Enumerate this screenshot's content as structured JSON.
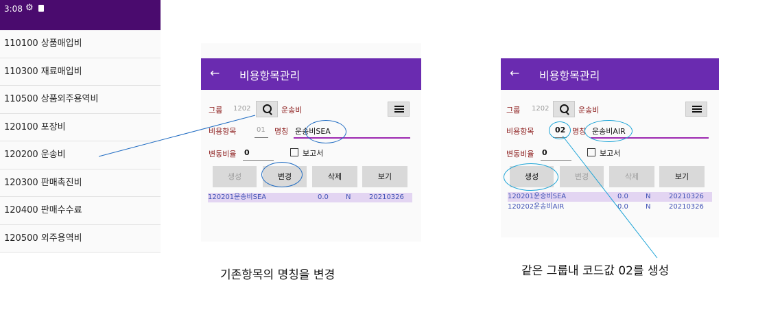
{
  "status_bar": {
    "time": "3:08",
    "icons": [
      "gear-icon",
      "sd-card-icon"
    ]
  },
  "code_list": [
    "110100 상품매입비",
    "110300 재료매입비",
    "110500 상품외주용역비",
    "120100 포장비",
    "120200 운송비",
    "120300 판매촉진비",
    "120400 판매수수료",
    "120500 외주용역비"
  ],
  "screen1": {
    "title": "비용항목관리",
    "group_label": "그룹",
    "group_code": "1202",
    "group_name": "운송비",
    "item_label": "비용항목",
    "item_code": "01",
    "name_label": "명칭",
    "name_value": "운송비SEA",
    "rate_label": "변동비율",
    "rate_value": "0",
    "report_label": "보고서",
    "buttons": {
      "create": "생성",
      "change": "변경",
      "delete": "삭제",
      "view": "보기"
    },
    "rows": [
      {
        "code": "120201",
        "name": "운송비SEA",
        "rate": "0.0",
        "flag": "N",
        "date": "20210326"
      }
    ]
  },
  "screen2": {
    "title": "비용항목관리",
    "group_label": "그룹",
    "group_code": "1202",
    "group_name": "운송비",
    "item_label": "비용항목",
    "item_code": "02",
    "name_label": "명칭",
    "name_value": "운송비AIR",
    "rate_label": "변동비율",
    "rate_value": "0",
    "report_label": "보고서",
    "buttons": {
      "create": "생성",
      "change": "변경",
      "delete": "삭제",
      "view": "보기"
    },
    "rows": [
      {
        "code": "120201",
        "name": "운송비SEA",
        "rate": "0.0",
        "flag": "N",
        "date": "20210326"
      },
      {
        "code": "120202",
        "name": "운송비AIR",
        "rate": "0.0",
        "flag": "N",
        "date": "20210326"
      }
    ]
  },
  "captions": {
    "left": "기존항목의 명칭을 변경",
    "right": "같은 그룹내 코드값 02를 생성"
  },
  "colors": {
    "status_bar": "#4a0b6e",
    "app_bar": "#6a2bb0",
    "annotation": "#1e6bc2"
  }
}
